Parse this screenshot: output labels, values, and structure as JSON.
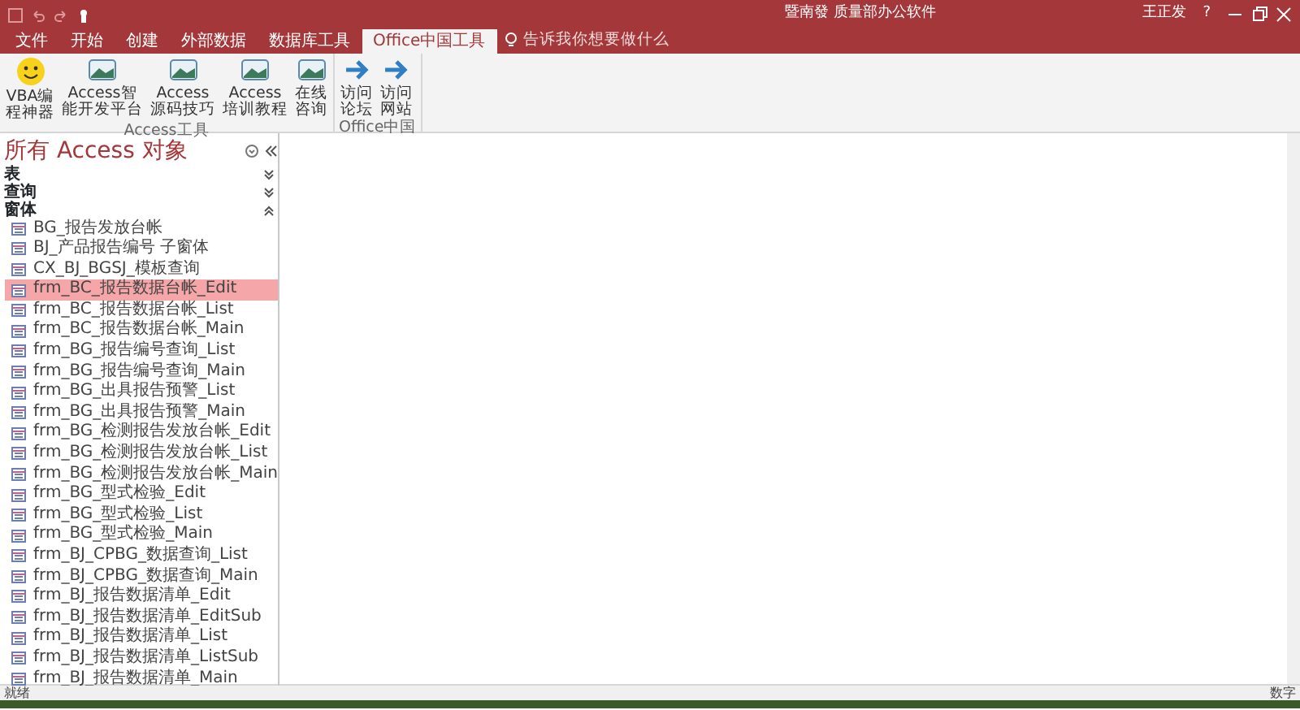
{
  "window": {
    "title": "暨南發 质量部办公软件",
    "user": "王正发",
    "help": "?"
  },
  "tabs": [
    {
      "label": "文件",
      "selected": false
    },
    {
      "label": "开始",
      "selected": false
    },
    {
      "label": "创建",
      "selected": false
    },
    {
      "label": "外部数据",
      "selected": false
    },
    {
      "label": "数据库工具",
      "selected": false
    },
    {
      "label": "Office中国工具",
      "selected": true
    }
  ],
  "tell_me": {
    "placeholder": "告诉我你想要做什么"
  },
  "ribbon_groups": [
    {
      "label": "Access工具",
      "buttons": [
        {
          "kind": "smiley",
          "lines": [
            "VBA编",
            "程神器"
          ]
        },
        {
          "kind": "picture",
          "lines": [
            "Access智",
            "能开发平台"
          ]
        },
        {
          "kind": "picture",
          "lines": [
            "Access",
            "源码技巧"
          ]
        },
        {
          "kind": "picture",
          "lines": [
            "Access",
            "培训教程"
          ]
        },
        {
          "kind": "picture",
          "lines": [
            "在线",
            "咨询"
          ]
        }
      ]
    },
    {
      "label": "Office中国",
      "buttons": [
        {
          "kind": "arrow",
          "lines": [
            "访问",
            "论坛"
          ]
        },
        {
          "kind": "arrow",
          "lines": [
            "访问",
            "网站"
          ]
        }
      ]
    }
  ],
  "navigation": {
    "title": "所有 Access 对象",
    "groups": [
      {
        "label": "表",
        "expanded": false
      },
      {
        "label": "查询",
        "expanded": false
      },
      {
        "label": "窗体",
        "expanded": true,
        "items": [
          {
            "label": "BG_报告发放台帐",
            "selected": false
          },
          {
            "label": "BJ_产品报告编号 子窗体",
            "selected": false
          },
          {
            "label": "CX_BJ_BGSJ_模板查询",
            "selected": false
          },
          {
            "label": "frm_BC_报告数据台帐_Edit",
            "selected": true
          },
          {
            "label": "frm_BC_报告数据台帐_List",
            "selected": false
          },
          {
            "label": "frm_BC_报告数据台帐_Main",
            "selected": false
          },
          {
            "label": "frm_BG_报告编号查询_List",
            "selected": false
          },
          {
            "label": "frm_BG_报告编号查询_Main",
            "selected": false
          },
          {
            "label": "frm_BG_出具报告预警_List",
            "selected": false
          },
          {
            "label": "frm_BG_出具报告预警_Main",
            "selected": false
          },
          {
            "label": "frm_BG_检测报告发放台帐_Edit",
            "selected": false
          },
          {
            "label": "frm_BG_检测报告发放台帐_List",
            "selected": false
          },
          {
            "label": "frm_BG_检测报告发放台帐_Main",
            "selected": false
          },
          {
            "label": "frm_BG_型式检验_Edit",
            "selected": false
          },
          {
            "label": "frm_BG_型式检验_List",
            "selected": false
          },
          {
            "label": "frm_BG_型式检验_Main",
            "selected": false
          },
          {
            "label": "frm_BJ_CPBG_数据查询_List",
            "selected": false
          },
          {
            "label": "frm_BJ_CPBG_数据查询_Main",
            "selected": false
          },
          {
            "label": "frm_BJ_报告数据清单_Edit",
            "selected": false
          },
          {
            "label": "frm_BJ_报告数据清单_EditSub",
            "selected": false
          },
          {
            "label": "frm_BJ_报告数据清单_List",
            "selected": false
          },
          {
            "label": "frm_BJ_报告数据清单_ListSub",
            "selected": false
          },
          {
            "label": "frm_BJ_报告数据清单_Main",
            "selected": false
          }
        ]
      }
    ]
  },
  "status_bar": {
    "left": "就绪",
    "right": "数字"
  }
}
